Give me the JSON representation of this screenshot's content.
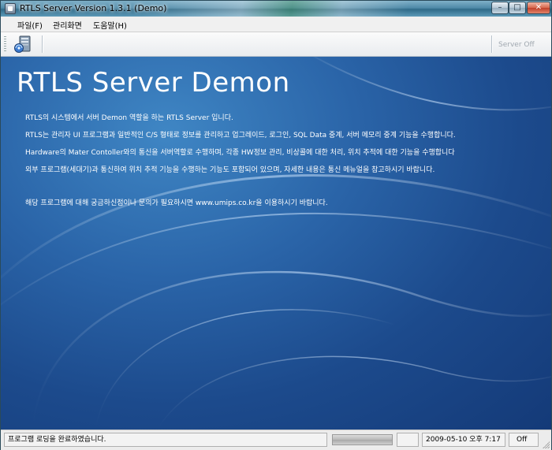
{
  "window": {
    "title": "RTLS Server Version 1.3.1 (Demo)",
    "controls": {
      "minimize": "–",
      "maximize": "□",
      "close": "✕"
    }
  },
  "menu": {
    "items": [
      {
        "label": "파일(F)"
      },
      {
        "label": "관리화면"
      },
      {
        "label": "도움말(H)"
      }
    ]
  },
  "toolbar": {
    "server_button_icon": "server-icon",
    "server_status": "Server Off"
  },
  "content": {
    "title": "RTLS Server Demon",
    "lines": [
      "RTLS의 시스템에서 서버 Demon 역할을 하는 RTLS Server 입니다.",
      "RTLS는 관리자 UI 프로그램과 일반적인 C/S 형태로 정보를 관리하고 업그레이드, 로그인, SQL Data 중계, 서버 메모리 중계 기능을 수행합니다.",
      "Hardware의 Mater Contoller와의 통신을 서버역할로 수행하며, 각종 HW정보 관리, 비상콜에 대한 처리, 위치 추적에 대한 기능을 수행합니다",
      "외부 프로그램(세대기)과 통신하여 위치 추적 기능을 수행하는 기능도 포함되어 있으며, 자세한 내용은 통신 메뉴얼을 참고하시기 바랍니다.",
      "해당 프로그램에 대해 궁금하신점이나 문의가 필요하시면 www.umips.co.kr을 이용하시기 바랍니다."
    ],
    "background_color": "#2a64a8"
  },
  "statusbar": {
    "message": "프로그램 로딩을 완료하였습니다.",
    "datetime": "2009-05-10 오후 7:17",
    "state": "Off"
  }
}
